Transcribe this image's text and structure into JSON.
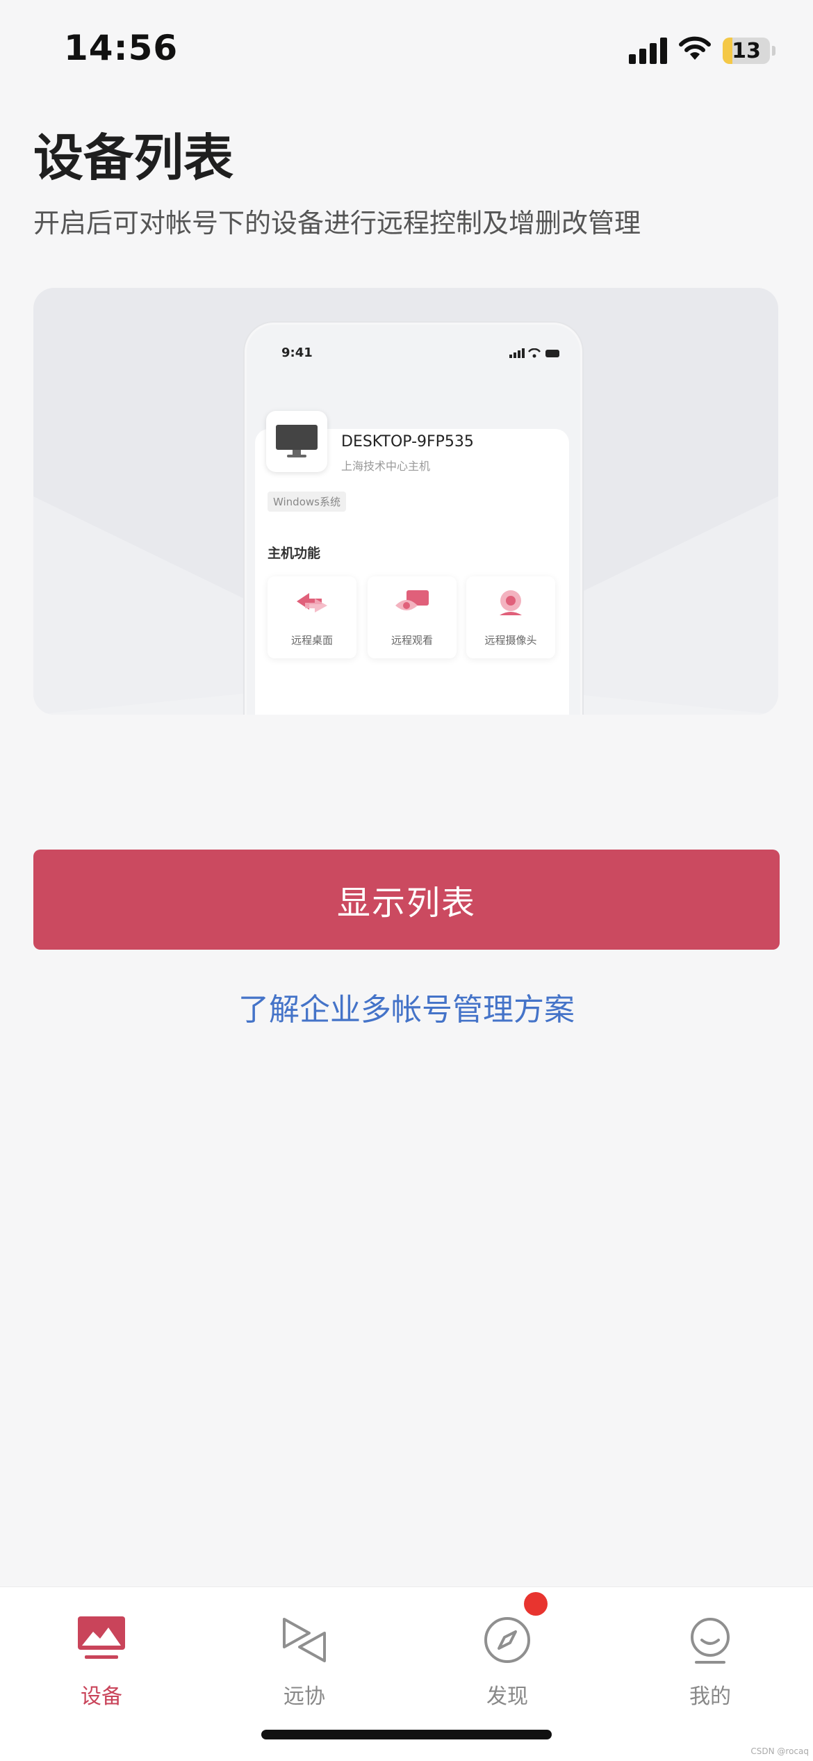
{
  "status_bar": {
    "time": "14:56",
    "battery": "13"
  },
  "page": {
    "title": "设备列表",
    "description": "开启后可对帐号下的设备进行远程控制及增删改管理"
  },
  "illustration": {
    "time": "9:41",
    "device_name": "DESKTOP-9FP535",
    "device_sub": "上海技术中心主机",
    "tag": "Windows系统",
    "section_title": "主机功能",
    "functions": [
      {
        "label": "远程桌面",
        "icon": "remote-desktop-icon"
      },
      {
        "label": "远程观看",
        "icon": "remote-view-icon"
      },
      {
        "label": "远程摄像头",
        "icon": "remote-camera-icon"
      }
    ]
  },
  "actions": {
    "primary_label": "显示列表",
    "link_label": "了解企业多帐号管理方案"
  },
  "tab_bar": {
    "items": [
      {
        "label": "设备",
        "icon": "device-icon",
        "active": true
      },
      {
        "label": "远协",
        "icon": "remote-assist-icon",
        "active": false
      },
      {
        "label": "发现",
        "icon": "compass-icon",
        "active": false
      },
      {
        "label": "我的",
        "icon": "profile-icon",
        "active": false
      }
    ]
  },
  "watermark": "CSDN @rocaq",
  "colors": {
    "accent": "#cb4a60",
    "link": "#4473c8",
    "badge": "#e8342f"
  }
}
